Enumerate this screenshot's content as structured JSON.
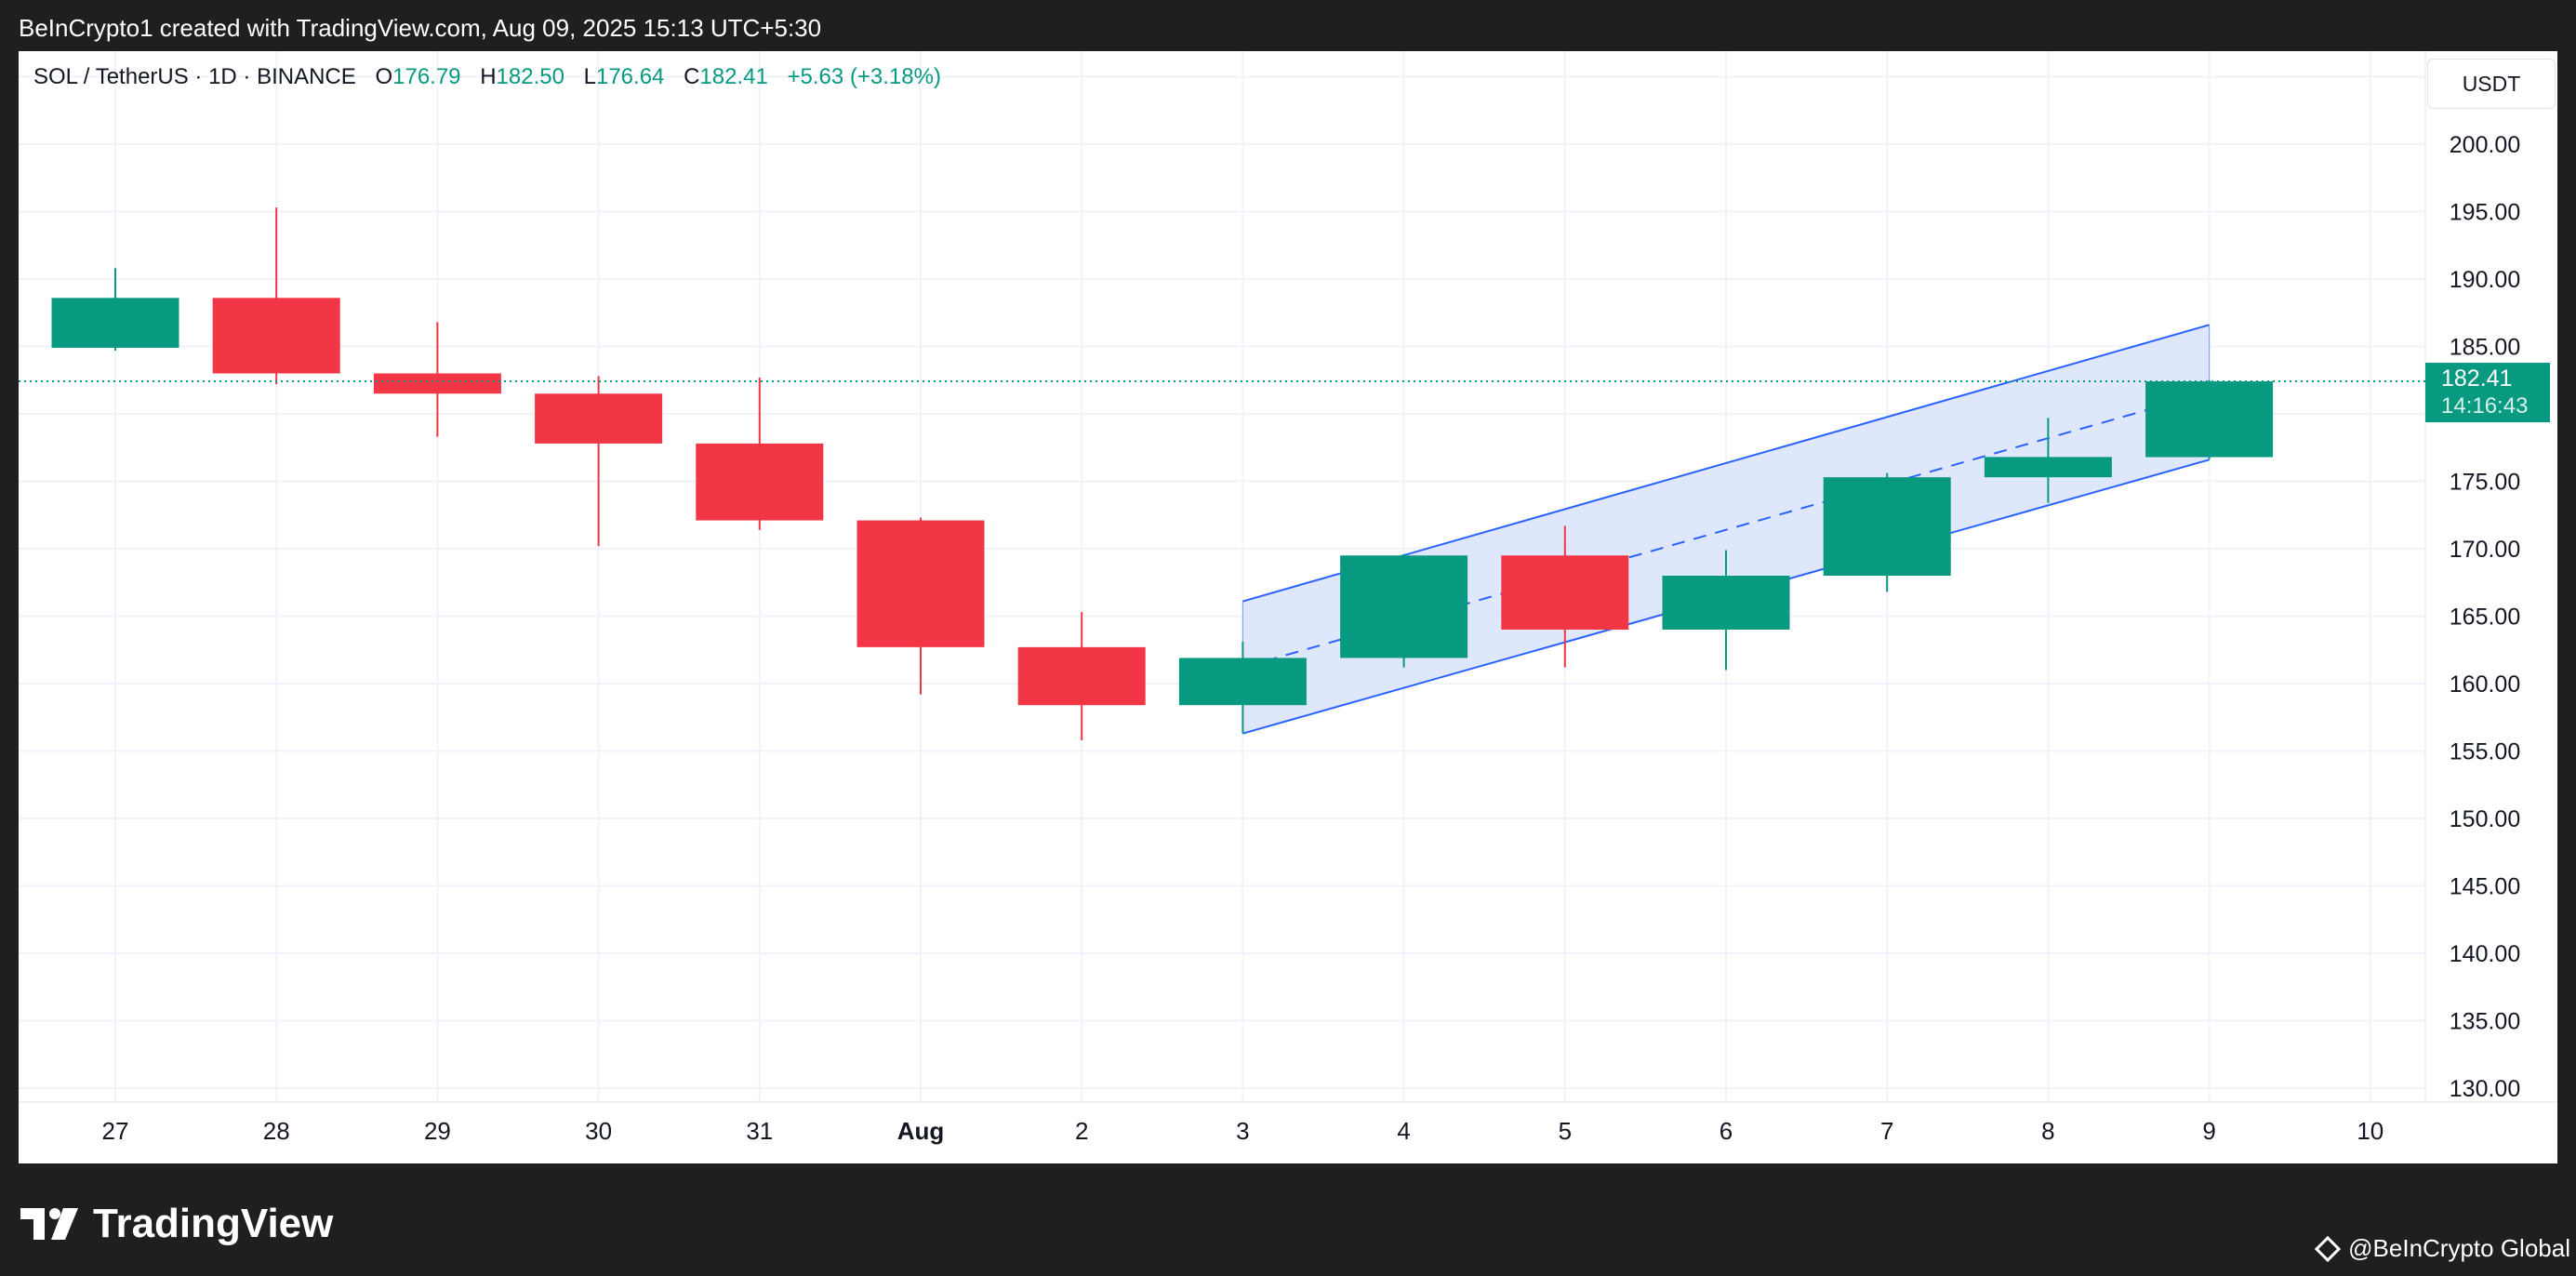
{
  "header": {
    "attribution": "BeInCrypto1 created with TradingView.com, Aug 09, 2025 15:13 UTC+5:30"
  },
  "legend": {
    "symbol": "SOL / TetherUS · 1D · BINANCE",
    "open_label": "O",
    "open_value": "176.79",
    "high_label": "H",
    "high_value": "182.50",
    "low_label": "L",
    "low_value": "176.64",
    "close_label": "C",
    "close_value": "182.41",
    "change": "+5.63 (+3.18%)"
  },
  "currency": "USDT",
  "footer": {
    "logo_text": "TradingView",
    "credit": "@BeInCrypto Global"
  },
  "colors": {
    "up": "#089981",
    "down": "#f23645",
    "channel_line": "#2962ff",
    "channel_fill": "#dbe4fd",
    "grid": "#f0f3fa",
    "text": "#131722"
  },
  "chart_data": {
    "type": "candlestick",
    "x_ticks": [
      "27",
      "28",
      "29",
      "30",
      "31",
      "Aug",
      "2",
      "3",
      "4",
      "5",
      "6",
      "7",
      "8",
      "9",
      "10"
    ],
    "y_ticks": [
      "130.00",
      "135.00",
      "140.00",
      "145.00",
      "150.00",
      "155.00",
      "160.00",
      "165.00",
      "170.00",
      "175.00",
      "180.00",
      "185.00",
      "190.00",
      "195.00",
      "200.00"
    ],
    "ylim": [
      126,
      207
    ],
    "candles": [
      {
        "x": "27",
        "open": 184.9,
        "high": 190.8,
        "low": 184.7,
        "close": 188.6
      },
      {
        "x": "28",
        "open": 188.6,
        "high": 195.3,
        "low": 182.2,
        "close": 183.0
      },
      {
        "x": "29",
        "open": 183.0,
        "high": 186.8,
        "low": 178.3,
        "close": 181.5
      },
      {
        "x": "30",
        "open": 181.5,
        "high": 182.8,
        "low": 170.2,
        "close": 177.8
      },
      {
        "x": "31",
        "open": 177.8,
        "high": 182.7,
        "low": 171.4,
        "close": 172.1
      },
      {
        "x": "Aug",
        "open": 172.1,
        "high": 172.3,
        "low": 159.2,
        "close": 162.7
      },
      {
        "x": "2",
        "open": 162.7,
        "high": 165.3,
        "low": 155.8,
        "close": 158.4
      },
      {
        "x": "3",
        "open": 158.4,
        "high": 163.1,
        "low": 156.3,
        "close": 161.9
      },
      {
        "x": "4",
        "open": 161.9,
        "high": 169.6,
        "low": 161.2,
        "close": 169.5
      },
      {
        "x": "5",
        "open": 169.5,
        "high": 171.7,
        "low": 161.2,
        "close": 164.0
      },
      {
        "x": "6",
        "open": 164.0,
        "high": 169.9,
        "low": 161.0,
        "close": 168.0
      },
      {
        "x": "7",
        "open": 168.0,
        "high": 175.6,
        "low": 166.8,
        "close": 175.3
      },
      {
        "x": "8",
        "open": 175.3,
        "high": 179.7,
        "low": 173.4,
        "close": 176.8
      },
      {
        "x": "9",
        "open": 176.79,
        "high": 182.5,
        "low": 176.64,
        "close": 182.41
      }
    ],
    "channel": {
      "start_x": "3",
      "end_x": "9",
      "upper": [
        166.1,
        186.6
      ],
      "middle": [
        161.2,
        181.6
      ],
      "lower": [
        156.3,
        176.6
      ]
    },
    "last_price": "182.41",
    "countdown": "14:16:43"
  }
}
